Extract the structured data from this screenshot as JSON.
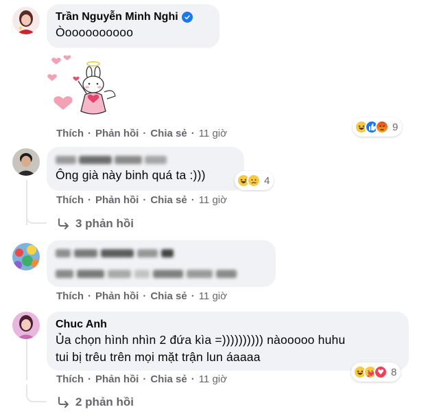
{
  "comments": [
    {
      "author": "Trần Nguyễn Minh Nghi",
      "verified": true,
      "text": "Òoooooooooo",
      "sticker": "angel-bunny-heart-sticker",
      "actions": {
        "like": "Thích",
        "reply": "Phản hồi",
        "share": "Chia sẻ",
        "time": "11 giờ"
      },
      "reactions": {
        "icons": [
          "haha-icon",
          "like-icon",
          "angry-icon"
        ],
        "count": "9"
      }
    },
    {
      "author_hidden": true,
      "text": "Ông già này binh quá ta :)))",
      "actions": {
        "like": "Thích",
        "reply": "Phản hồi",
        "share": "Chia sẻ",
        "time": "11 giờ"
      },
      "reactions": {
        "icons": [
          "haha-icon",
          "sad-icon"
        ],
        "count": "4"
      },
      "replies": "3 phản hồi"
    },
    {
      "author_hidden": true,
      "text_hidden": true,
      "actions": {
        "like": "Thích",
        "reply": "Phản hồi",
        "share": "Chia sẻ",
        "time": "11 giờ"
      }
    },
    {
      "author": "Chuc Anh",
      "text_line1": "Ủa chọn hình nhìn 2 đứa kìa =)))))))))) nàooooo huhu",
      "text_line2": "tui bị trêu trên mọi mặt trận lun áaaaa",
      "actions": {
        "like": "Thích",
        "reply": "Phản hồi",
        "share": "Chia sẻ",
        "time": "11 giờ"
      },
      "reactions": {
        "icons": [
          "haha-icon",
          "care-icon",
          "love-icon"
        ],
        "count": "8"
      },
      "replies": "2 phản hồi"
    }
  ],
  "colors": {
    "bubble": "#f0f2f5",
    "secondary_text": "#65676b",
    "verified": "#1877f2",
    "love": "#f33e58",
    "angry": "#e9710f"
  }
}
